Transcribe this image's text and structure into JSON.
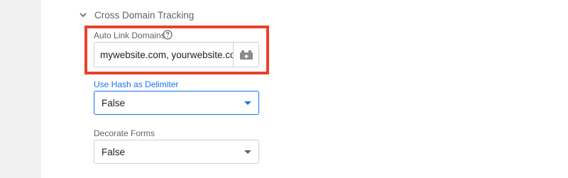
{
  "section": {
    "title": "Cross Domain Tracking",
    "icon": "chevron-down-icon"
  },
  "auto_link": {
    "label": "Auto Link Domains",
    "help_icon": "help-circle-icon",
    "value": "mywebsite.com, yourwebsite.com",
    "variable_button_icon": "variable-picker-icon",
    "highlight_color": "#e8412c"
  },
  "use_hash": {
    "label": "Use Hash as Delimiter",
    "selected": "False",
    "label_color": "#1a73e8"
  },
  "decorate_forms": {
    "label": "Decorate Forms",
    "selected": "False"
  }
}
